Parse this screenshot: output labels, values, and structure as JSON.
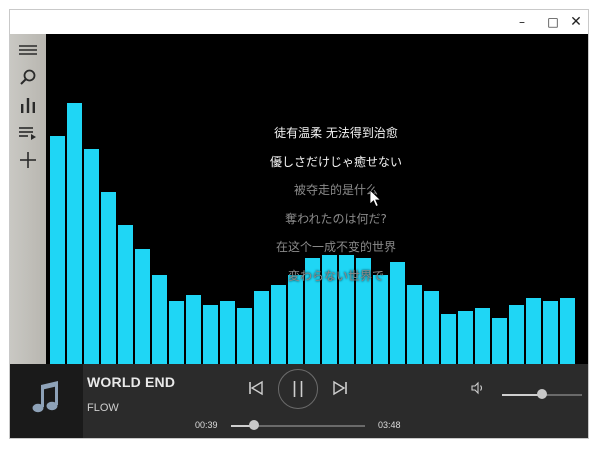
{
  "window": {
    "minimize_glyph": "–",
    "maximize_glyph": "□",
    "close_glyph": "✕"
  },
  "sidebar": {
    "items": [
      {
        "name": "menu",
        "icon": "hamburger-menu-icon"
      },
      {
        "name": "search",
        "icon": "search-icon"
      },
      {
        "name": "equalizer",
        "icon": "bar-chart-icon"
      },
      {
        "name": "playlist",
        "icon": "playlist-icon"
      },
      {
        "name": "add",
        "icon": "plus-icon"
      }
    ]
  },
  "visualizer": {
    "bar_color": "#1fd6f5",
    "levels": [
      0.69,
      0.79,
      0.65,
      0.52,
      0.42,
      0.35,
      0.27,
      0.19,
      0.21,
      0.18,
      0.19,
      0.17,
      0.22,
      0.24,
      0.27,
      0.32,
      0.33,
      0.33,
      0.32,
      0.27,
      0.31,
      0.24,
      0.22,
      0.15,
      0.16,
      0.17,
      0.14,
      0.18,
      0.2,
      0.19,
      0.2
    ]
  },
  "lyrics": {
    "lines": [
      {
        "text": "徒有温柔 无法得到治愈",
        "active": true
      },
      {
        "text": "優しさだけじゃ癒せない",
        "active": true
      },
      {
        "text": "被夺走的是什么",
        "active": false
      },
      {
        "text": "奪われたのは何だ?",
        "active": false
      },
      {
        "text": "在这个一成不变的世界",
        "active": false
      },
      {
        "text": "変わらない世界で",
        "active": false
      }
    ]
  },
  "player": {
    "album_icon": "music-note-icon",
    "song_title": "WORLD END",
    "artist": "FLOW",
    "current_time": "00:39",
    "total_time": "03:48",
    "progress": 0.17,
    "volume": 0.5,
    "accent_color": "#1fd6f5"
  }
}
